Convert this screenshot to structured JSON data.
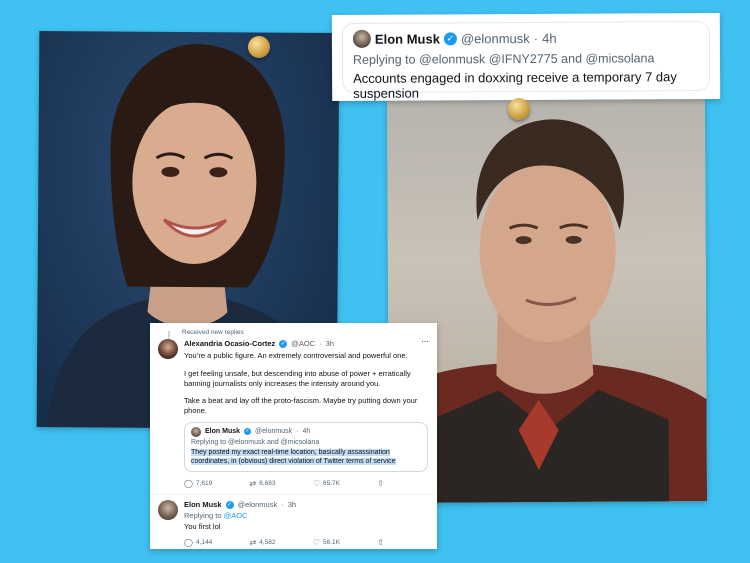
{
  "top_tweet": {
    "name": "Elon Musk",
    "handle": "@elonmusk",
    "dot": "·",
    "time": "4h",
    "replying_prefix": "Replying to",
    "replying_to": "@elonmusk @IFNY2775 and @micsolana",
    "text": "Accounts engaged in doxxing receive a temporary 7 day suspension"
  },
  "thread": {
    "notice": "Received new replies",
    "aoc": {
      "name": "Alexandria Ocasio-Cortez",
      "handle": "@AOC",
      "dot": "·",
      "time": "3h",
      "more": "···",
      "p1": "You’re a public figure. An extremely controversial and powerful one.",
      "p2": "I get feeling unsafe, but descending into abuse of power + erratically banning journalists only increases the intensity around you.",
      "p3": "Take a beat and lay off the proto-fascism. Maybe try putting down your phone.",
      "quote": {
        "name": "Elon Musk",
        "handle": "@elonmusk",
        "dot": "·",
        "time": "4h",
        "replying": "Replying to @elonmusk and @micsolana",
        "text": "They posted my exact real-time location, basically assassination coordinates, in (obvious) direct violation of Twitter terms of service"
      },
      "stats": {
        "replies": "7,619",
        "retweets": "6,683",
        "likes": "65.7K"
      }
    },
    "elon_reply": {
      "name": "Elon Musk",
      "handle": "@elonmusk",
      "dot": "·",
      "time": "3h",
      "replying_prefix": "Replying to",
      "replying_to": "@AOC",
      "text": "You first lol",
      "stats": {
        "replies": "4,144",
        "retweets": "4,582",
        "likes": "56.1K"
      }
    }
  },
  "icons": {
    "verified": "✓",
    "reply": "◯",
    "retweet": "⇄",
    "like": "♡",
    "share": "⇧"
  },
  "colors": {
    "background": "#3fc1f1",
    "accent": "#1d9bf0",
    "highlight": "#c5dcf5"
  }
}
